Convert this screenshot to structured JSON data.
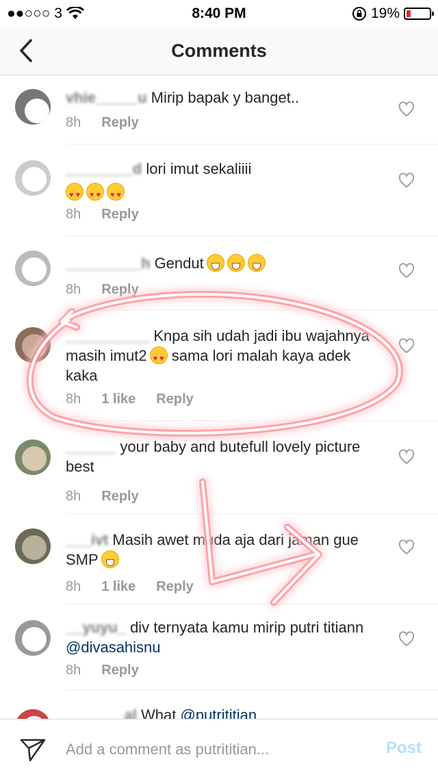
{
  "status_bar": {
    "carrier": "●●○○○ 3",
    "time": "8:40 PM",
    "battery": "19%",
    "battery_level": 0.19,
    "battery_color": "#e3262b"
  },
  "header": {
    "title": "Comments",
    "back_icon": "chevron-left-icon"
  },
  "comments": [
    {
      "user": "vhie_____u",
      "text": "Mirip bapak y banget..",
      "time": "8h",
      "likes": "",
      "reply": "Reply"
    },
    {
      "user": "________d",
      "text": "lori imut sekaliiii",
      "emojis": [
        "heart-eyes",
        "heart-eyes",
        "heart-eyes"
      ],
      "time": "8h",
      "likes": "",
      "reply": "Reply"
    },
    {
      "user": "_________h",
      "text": "Gendut",
      "emojis": [
        "grin",
        "grin",
        "grin"
      ],
      "time": "8h",
      "likes": "",
      "reply": "Reply"
    },
    {
      "user": "__________",
      "text": "Knpa sih udah jadi ibu wajahnya masih imut2",
      "text_after": "sama lori malah kaya adek kaka",
      "emojis": [
        "heart-eyes"
      ],
      "time": "8h",
      "likes": "1 like",
      "reply": "Reply"
    },
    {
      "user": "______",
      "text": "your baby and butefull lovely picture best",
      "time": "8h",
      "likes": "",
      "reply": "Reply"
    },
    {
      "user": "___ivt",
      "text": "Masih awet muda aja dari jaman gue SMP",
      "emojis": [
        "sweat-smile"
      ],
      "time": "8h",
      "likes": "1 like",
      "reply": "Reply"
    },
    {
      "user": "__yuyu_",
      "text": "div ternyata kamu mirip putri titiann",
      "mention": "@divasahisnu",
      "time": "8h",
      "likes": "",
      "reply": "Reply"
    },
    {
      "user": "_______al",
      "text": "What",
      "mention": "@putrititian",
      "time": "",
      "likes": "",
      "reply": ""
    }
  ],
  "input_bar": {
    "placeholder": "Add a comment as putrititian...",
    "post_label": "Post",
    "post_color": "#b2dffc",
    "send_icon": "send-icon"
  }
}
